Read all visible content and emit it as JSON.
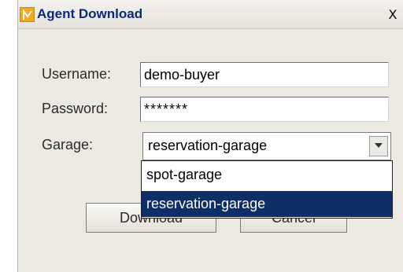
{
  "window": {
    "title": "Agent Download",
    "close_glyph": "X"
  },
  "form": {
    "username_label": "Username:",
    "username_value": "demo-buyer",
    "password_label": "Password:",
    "password_value": "*******",
    "garage_label": "Garage:",
    "garage_selected": "reservation-garage",
    "garage_options": [
      "spot-garage",
      "reservation-garage"
    ]
  },
  "buttons": {
    "download": "Download",
    "cancel": "Cancel"
  },
  "colors": {
    "title_text": "#0b2a7a",
    "selection_bg": "#0d2e66",
    "app_icon": "#f4a81c"
  },
  "icons": {
    "app": "agent-app-icon",
    "close": "close-icon",
    "dropdown": "chevron-down-icon"
  }
}
